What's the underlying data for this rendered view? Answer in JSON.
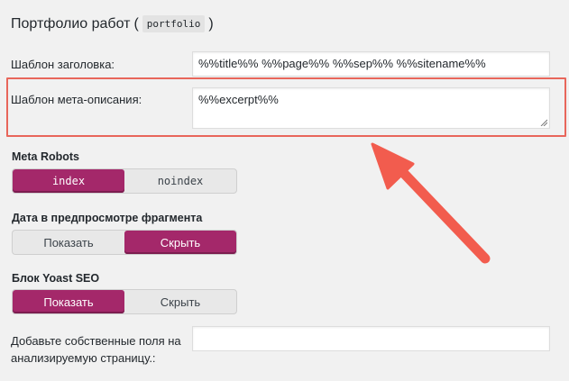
{
  "header": {
    "title": "Портфолио работ",
    "open_paren": "(",
    "slug": "portfolio",
    "close_paren": ")"
  },
  "fields": {
    "title_template_label": "Шаблон заголовка:",
    "title_template_value": "%%title%% %%page%% %%sep%% %%sitename%%",
    "meta_template_label": "Шаблон мета-описания:",
    "meta_template_value": "%%excerpt%%",
    "custom_fields_label_line1": "Добавьте собственные поля на",
    "custom_fields_label_line2": "анализируемую страницу.:",
    "custom_fields_value": ""
  },
  "meta_robots": {
    "label": "Meta Robots",
    "options": [
      "index",
      "noindex"
    ],
    "selected": "index"
  },
  "snippet_date": {
    "label": "Дата в предпросмотре фрагмента",
    "options": [
      "Показать",
      "Скрыть"
    ],
    "selected": "Скрыть"
  },
  "yoast_block": {
    "label": "Блок Yoast SEO",
    "options": [
      "Показать",
      "Скрыть"
    ],
    "selected": "Показать"
  },
  "colors": {
    "accent": "#a4286a",
    "highlight": "#e8665b",
    "arrow": "#f25c4e"
  },
  "icons": {
    "arrow": "annotation-arrow-icon",
    "resize": "resize-handle-icon"
  }
}
